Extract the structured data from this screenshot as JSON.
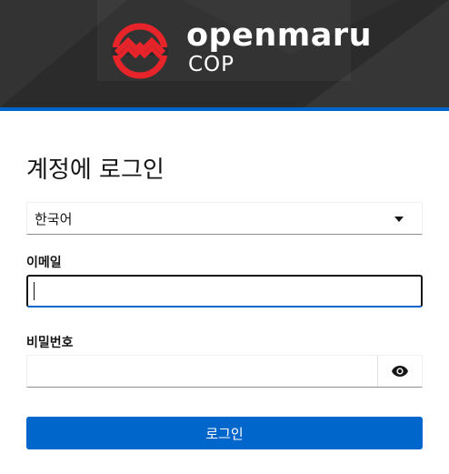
{
  "header": {
    "brand_name": "openmaru",
    "product_name": "COP",
    "logo_icon": "openmaru-mountain-logo-icon",
    "colors": {
      "background": "#2b2b2b",
      "accent_bar": "#0066cc",
      "logo_red": "#e8242b"
    }
  },
  "form": {
    "title": "계정에 로그인",
    "locale": {
      "selected": "한국어",
      "icon": "caret-down-icon"
    },
    "email": {
      "label": "이메일",
      "value": ""
    },
    "password": {
      "label": "비밀번호",
      "value": "",
      "toggle_icon": "eye-icon"
    },
    "submit_label": "로그인",
    "colors": {
      "primary": "#0066cc"
    }
  }
}
